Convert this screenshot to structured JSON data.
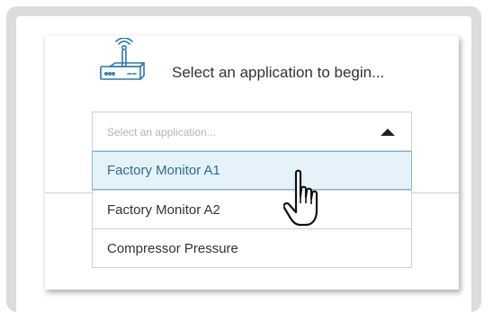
{
  "header": {
    "icon": "router-icon",
    "text": "Select an application to begin..."
  },
  "select": {
    "placeholder": "Select an application...",
    "arrow_icon": "caret-up-icon"
  },
  "options": [
    {
      "label": "Factory Monitor A1",
      "highlighted": true
    },
    {
      "label": "Factory Monitor A2",
      "highlighted": false
    },
    {
      "label": "Compressor Pressure",
      "highlighted": false
    }
  ],
  "cursor_icon": "hand-pointer-icon",
  "colors": {
    "highlight_bg": "#e6f2fa",
    "highlight_text": "#2f6b92",
    "highlight_border": "#7fb6d6"
  }
}
